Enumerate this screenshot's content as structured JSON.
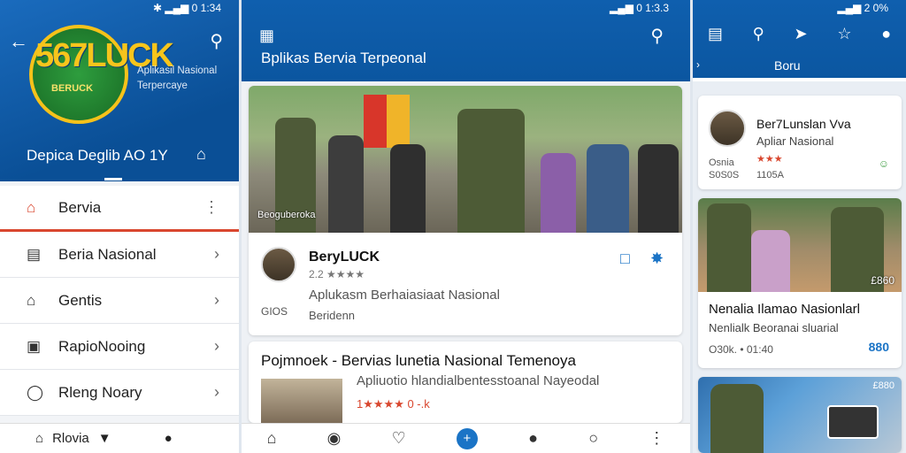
{
  "screen1": {
    "status": "✱ ▂▄▆ 0 1:34",
    "logo_text": "567LUCK",
    "logo_sub": "BERUCK",
    "app_sub": "Aplikasil Nasional\nTerpercaye",
    "tagline": "Depica Deglib AO 1Y",
    "menu": [
      {
        "label": "Bervia",
        "icon": "home-icon"
      },
      {
        "label": "Beria Nasional",
        "icon": "book-icon"
      },
      {
        "label": "Gentis",
        "icon": "house-icon"
      },
      {
        "label": "RapioNooing",
        "icon": "radio-icon"
      },
      {
        "label": "Rleng Noary",
        "icon": "chat-icon"
      }
    ],
    "bottom_label": "Rlovia"
  },
  "screen2": {
    "status": "▂▄▆ 0 1:3.3",
    "title": "Bplikas Bervia Terpeonal",
    "card1": {
      "caption": "Beoguberoka",
      "title": "BeryLUCK",
      "rating": "2.2 ★★★★",
      "sub": "Aplukasm Berhaiasiaat Nasional",
      "num": "GIOS",
      "date": "Beridenn"
    },
    "card2": {
      "title": "Pojmnoek - Bervias lunetia Nasional Temenoya",
      "sub": "Apliuotio hlandialbentesstoanal Nayeodal",
      "rating": "1★★★★ 0 -.k"
    }
  },
  "screen3": {
    "status": "▂▄▆ 2 0%",
    "tab": "Boru",
    "card3": {
      "title": "Ber7Lunslan Vva",
      "sub": "Apliar Nasional",
      "stars": "★★★",
      "small1": "Osnia",
      "small2": "S0S0S",
      "count": "1105A"
    },
    "card4": {
      "num": "£860",
      "title": "Nenalia Ilamao Nasionlarl",
      "sub": "Nenlialk Beoranai sluarial",
      "meta": "O30k. • 01:40",
      "badge": "880"
    },
    "card5": {
      "num": "£880"
    }
  }
}
